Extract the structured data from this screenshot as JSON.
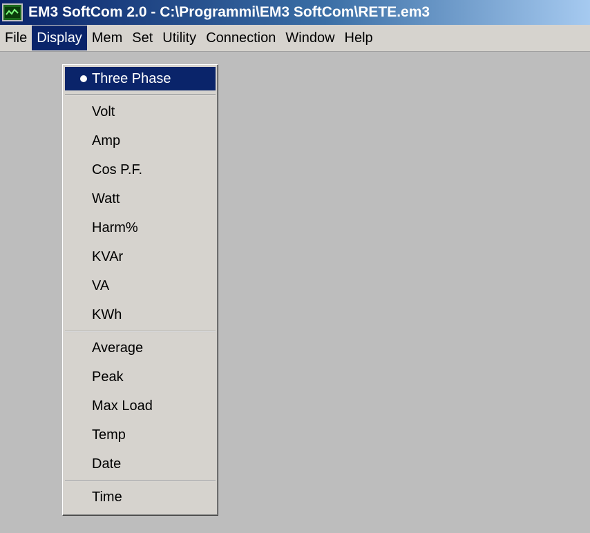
{
  "window": {
    "title": "EM3 SoftCom 2.0 - C:\\Programmi\\EM3 SoftCom\\RETE.em3",
    "icon": "app-monitor-icon"
  },
  "menubar": {
    "items": [
      "File",
      "Display",
      "Mem",
      "Set",
      "Utility",
      "Connection",
      "Window",
      "Help"
    ],
    "active": "Display"
  },
  "display_menu": {
    "selected": "Three Phase",
    "group1": [
      "Three Phase"
    ],
    "group2": [
      "Volt",
      "Amp",
      "Cos P.F.",
      "Watt",
      "Harm%",
      "KVAr",
      "VA",
      "KWh"
    ],
    "group3": [
      "Average",
      "Peak",
      "Max Load",
      "Temp",
      "Date"
    ],
    "group4": [
      "Time"
    ]
  },
  "colors": {
    "selection": "#0a246a",
    "menu_background": "#d6d3ce",
    "workspace": "#bdbdbd"
  }
}
